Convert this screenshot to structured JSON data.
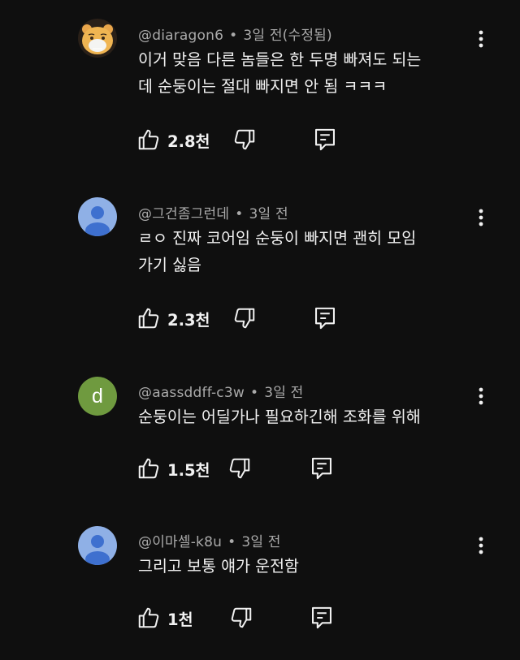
{
  "comments": [
    {
      "author": "@diaragon6",
      "time": "3일 전(수정됨)",
      "text_lines": [
        "이거 맞음 다른 놈들은 한 두명 빠져도 되는",
        "데 순둥이는 절대 빠지면 안 됨 ㅋㅋㅋ"
      ],
      "likes": "2.8천",
      "avatar": {
        "type": "image",
        "icon": "bear-mascot-avatar"
      }
    },
    {
      "author": "@그건좀그런데",
      "time": "3일 전",
      "text_lines": [
        "ㄹㅇ 진짜 코어임 순둥이 빠지면 괜히 모임",
        "가기 싫음"
      ],
      "likes": "2.3천",
      "avatar": {
        "type": "default",
        "color": "#8fb0e6",
        "icon": "person-icon"
      }
    },
    {
      "author": "@aassddff-c3w",
      "time": "3일 전",
      "text_lines": [
        "순둥이는 어딜가나 필요하긴해 조화를 위해"
      ],
      "likes": "1.5천",
      "avatar": {
        "type": "letter",
        "letter": "d",
        "color": "#6f9a3f"
      }
    },
    {
      "author": "@이마셀-k8u",
      "time": "3일 전",
      "text_lines": [
        "그리고 보통 얘가 운전함"
      ],
      "likes": "1천",
      "avatar": {
        "type": "default",
        "color": "#8fb0e6",
        "icon": "person-icon"
      }
    }
  ],
  "separator": "•",
  "icons": [
    "thumbs-up-icon",
    "thumbs-down-icon",
    "reply-icon",
    "more-vertical-icon"
  ],
  "colors": {
    "background": "#0f0f0f",
    "text": "#f1f1f1",
    "secondary": "#aaaaaa"
  }
}
